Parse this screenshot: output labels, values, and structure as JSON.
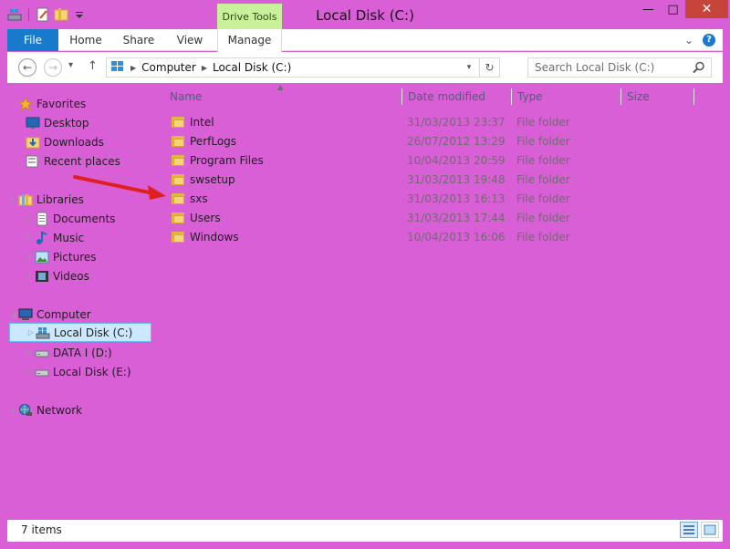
{
  "window": {
    "title": "Local Disk (C:)",
    "contextual_group": "Drive Tools",
    "controls": {
      "minimize": "—",
      "maximize": "□",
      "close": "✕"
    }
  },
  "ribbon": {
    "tabs": [
      {
        "label": "File"
      },
      {
        "label": "Home"
      },
      {
        "label": "Share"
      },
      {
        "label": "View"
      },
      {
        "label": "Manage"
      }
    ],
    "expand": "⌄",
    "help": "?"
  },
  "navigation": {
    "back": "←",
    "forward": "→",
    "recent": "▾",
    "up": "↑",
    "breadcrumbs": [
      "Computer",
      "Local Disk (C:)"
    ],
    "refresh": "↻",
    "dropdown": "▾",
    "search_placeholder": "Search Local Disk (C:)"
  },
  "sidebar": {
    "favorites": {
      "label": "Favorites",
      "items": [
        "Desktop",
        "Downloads",
        "Recent places"
      ]
    },
    "libraries": {
      "label": "Libraries",
      "items": [
        "Documents",
        "Music",
        "Pictures",
        "Videos"
      ]
    },
    "computer": {
      "label": "Computer",
      "items": [
        "Local Disk (C:)",
        "DATA I (D:)",
        "Local Disk (E:)"
      ],
      "selected": "Local Disk (C:)"
    },
    "network": {
      "label": "Network"
    }
  },
  "columns": {
    "name": "Name",
    "date": "Date modified",
    "type": "Type",
    "size": "Size"
  },
  "files": [
    {
      "name": "Intel",
      "date": "31/03/2013 23:37",
      "type": "File folder"
    },
    {
      "name": "PerfLogs",
      "date": "26/07/2012 13:29",
      "type": "File folder"
    },
    {
      "name": "Program Files",
      "date": "10/04/2013 20:59",
      "type": "File folder"
    },
    {
      "name": "swsetup",
      "date": "31/03/2013 19:48",
      "type": "File folder"
    },
    {
      "name": "sxs",
      "date": "31/03/2013 16:13",
      "type": "File folder"
    },
    {
      "name": "Users",
      "date": "31/03/2013 17:44",
      "type": "File folder"
    },
    {
      "name": "Windows",
      "date": "10/04/2013 16:06",
      "type": "File folder"
    }
  ],
  "status": {
    "count": "7 items"
  },
  "colors": {
    "accent": "#1979ca",
    "frame": "#d95fd6",
    "contextual": "#c9f09a",
    "annotation": "#e02020"
  }
}
